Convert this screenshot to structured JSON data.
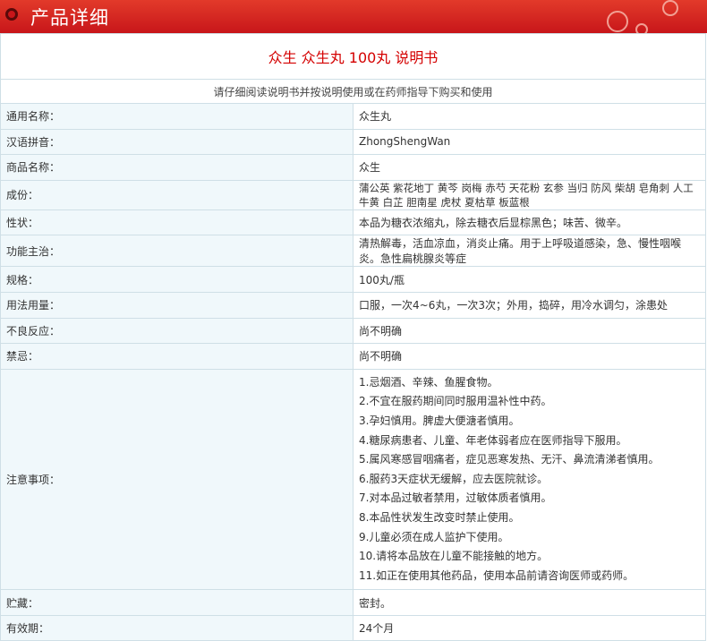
{
  "header": {
    "title": "产品详细"
  },
  "doc_title": "众生  众生丸  100丸  说明书",
  "notice": "请仔细阅读说明书并按说明使用或在药师指导下购买和使用",
  "rows": [
    {
      "label": "通用名称：",
      "value": "众生丸"
    },
    {
      "label": "汉语拼音：",
      "value": "ZhongShengWan"
    },
    {
      "label": "商品名称：",
      "value": "众生"
    },
    {
      "label": "成份：",
      "value": "蒲公英 紫花地丁 黄芩 岗梅 赤芍 天花粉 玄参 当归 防风 柴胡 皂角刺 人工牛黄 白芷 胆南星 虎杖 夏枯草 板蓝根"
    },
    {
      "label": "性状：",
      "value": "本品为糖衣浓缩丸，除去糖衣后显棕黑色；味苦、微辛。"
    },
    {
      "label": "功能主治：",
      "value": "清热解毒，活血凉血，消炎止痛。用于上呼吸道感染，急、慢性咽喉炎。急性扁桃腺炎等症"
    },
    {
      "label": "规格：",
      "value": "100丸/瓶"
    },
    {
      "label": "用法用量：",
      "value": "口服，一次4~6丸，一次3次；外用，捣碎，用冷水调匀，涂患处"
    },
    {
      "label": "不良反应：",
      "value": "尚不明确"
    },
    {
      "label": "禁忌：",
      "value": "尚不明确"
    }
  ],
  "precautions": {
    "label": "注意事项：",
    "items": [
      "1.忌烟酒、辛辣、鱼腥食物。",
      "2.不宜在服药期间同时服用温补性中药。",
      "3.孕妇慎用。脾虚大便溏者慎用。",
      "4.糖尿病患者、儿童、年老体弱者应在医师指导下服用。",
      "5.属风寒感冒咽痛者，症见恶寒发热、无汗、鼻流清涕者慎用。",
      "6.服药3天症状无缓解，应去医院就诊。",
      "7.对本品过敏者禁用，过敏体质者慎用。",
      "8.本品性状发生改变时禁止使用。",
      "9.儿童必须在成人监护下使用。",
      "10.请将本品放在儿童不能接触的地方。",
      "11.如正在使用其他药品，使用本品前请咨询医师或药师。"
    ]
  },
  "tail_rows": [
    {
      "label": "贮藏：",
      "value": "密封。"
    },
    {
      "label": "有效期：",
      "value": "24个月"
    }
  ]
}
